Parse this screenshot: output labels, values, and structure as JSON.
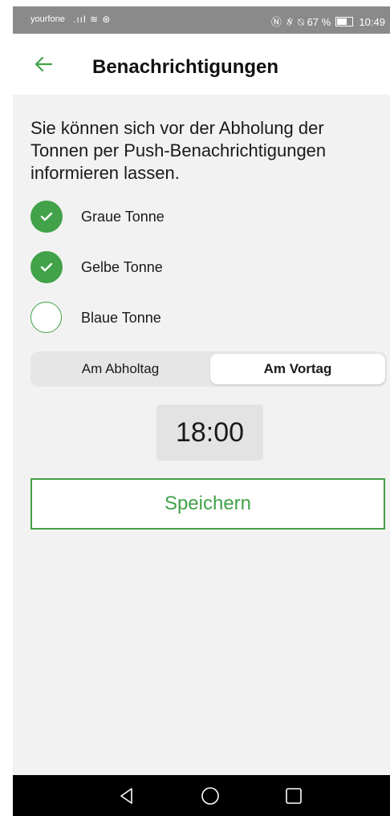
{
  "status_bar": {
    "carrier": "yourfone",
    "battery": "67 %",
    "time": "10:49"
  },
  "header": {
    "title": "Benachrichtigungen"
  },
  "main": {
    "description": "Sie können sich vor der Abholung der Tonnen per Push-Benachrichtigungen informieren lassen.",
    "options": [
      {
        "label": "Graue Tonne",
        "checked": true
      },
      {
        "label": "Gelbe Tonne",
        "checked": true
      },
      {
        "label": "Blaue Tonne",
        "checked": false
      }
    ],
    "segment": {
      "left_label": "Am Abholtag",
      "right_label": "Am Vortag",
      "selected": "Am Vortag"
    },
    "time": "18:00",
    "save_label": "Speichern"
  },
  "colors": {
    "accent": "#41a249",
    "background": "#f2f2f2"
  },
  "icons": {
    "back": "arrow-left-icon",
    "nav_back": "triangle-back-icon",
    "nav_home": "circle-home-icon",
    "nav_recent": "square-recent-icon"
  }
}
